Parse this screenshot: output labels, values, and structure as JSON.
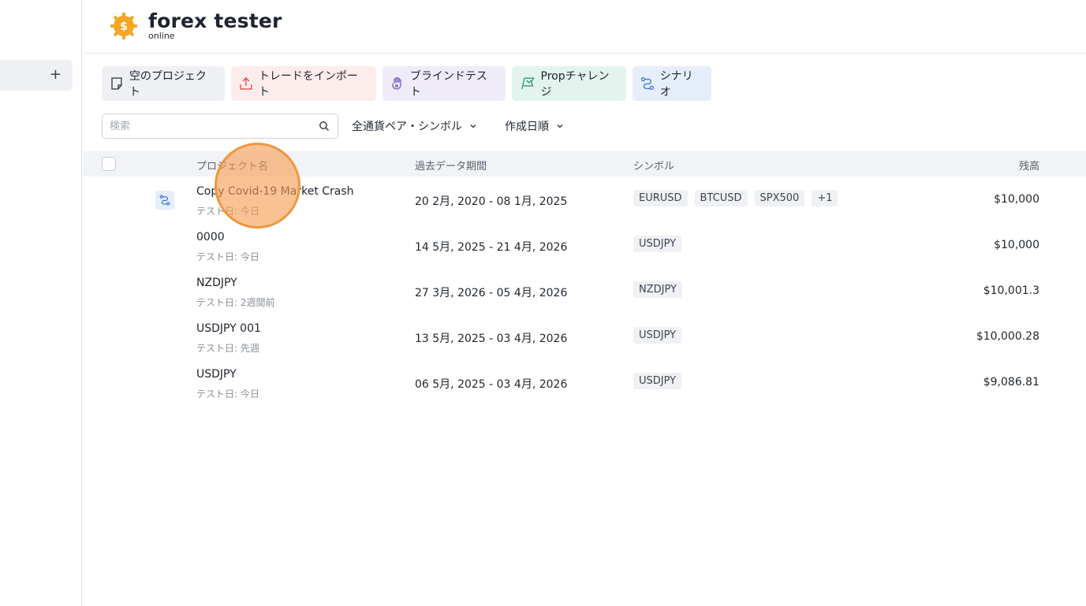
{
  "brand": {
    "title": "forex tester",
    "subtitle": "online",
    "accent": "#f5a623"
  },
  "sidebar": {
    "add_label": "+"
  },
  "actions": [
    {
      "label": "空のプロジェクト",
      "icon": "note-icon",
      "bg": "#eef0f3"
    },
    {
      "label": "トレードをインポート",
      "icon": "upload-icon",
      "bg": "#fdecec"
    },
    {
      "label": "ブラインドテスト",
      "icon": "blind-hand-icon",
      "bg": "#efecf8"
    },
    {
      "label": "Propチャレンジ",
      "icon": "flag-icon",
      "bg": "#e3f4ee"
    },
    {
      "label": "シナリオ",
      "icon": "route-icon",
      "bg": "#e6eefa"
    }
  ],
  "search": {
    "placeholder": "検索",
    "value": ""
  },
  "filters": {
    "symbol_label": "全通貨ペア・シンボル",
    "sort_label": "作成日順"
  },
  "table": {
    "headers": {
      "name": "プロジェクト名",
      "period": "過去データ期間",
      "symbol": "シンボル",
      "balance": "残高"
    },
    "rows": [
      {
        "name": "Copy Covid-19 Market Crash",
        "tested": "テスト日: 今日",
        "period": "20 2月, 2020 - 08 1月, 2025",
        "symbols": [
          "EURUSD",
          "BTCUSD",
          "SPX500",
          "+1"
        ],
        "balance": "$10,000",
        "scenario": true
      },
      {
        "name": "0000",
        "tested": "テスト日: 今日",
        "period": "14 5月, 2025 - 21 4月, 2026",
        "symbols": [
          "USDJPY"
        ],
        "balance": "$10,000",
        "scenario": false
      },
      {
        "name": "NZDJPY",
        "tested": "テスト日: 2週間前",
        "period": "27 3月, 2026 - 05 4月, 2026",
        "symbols": [
          "NZDJPY"
        ],
        "balance": "$10,001.3",
        "scenario": false
      },
      {
        "name": "USDJPY 001",
        "tested": "テスト日: 先週",
        "period": "13 5月, 2025 - 03 4月, 2026",
        "symbols": [
          "USDJPY"
        ],
        "balance": "$10,000.28",
        "scenario": false
      },
      {
        "name": "USDJPY",
        "tested": "テスト日: 今日",
        "period": "06 5月, 2025 - 03 4月, 2026",
        "symbols": [
          "USDJPY"
        ],
        "balance": "$9,086.81",
        "scenario": false
      }
    ]
  }
}
